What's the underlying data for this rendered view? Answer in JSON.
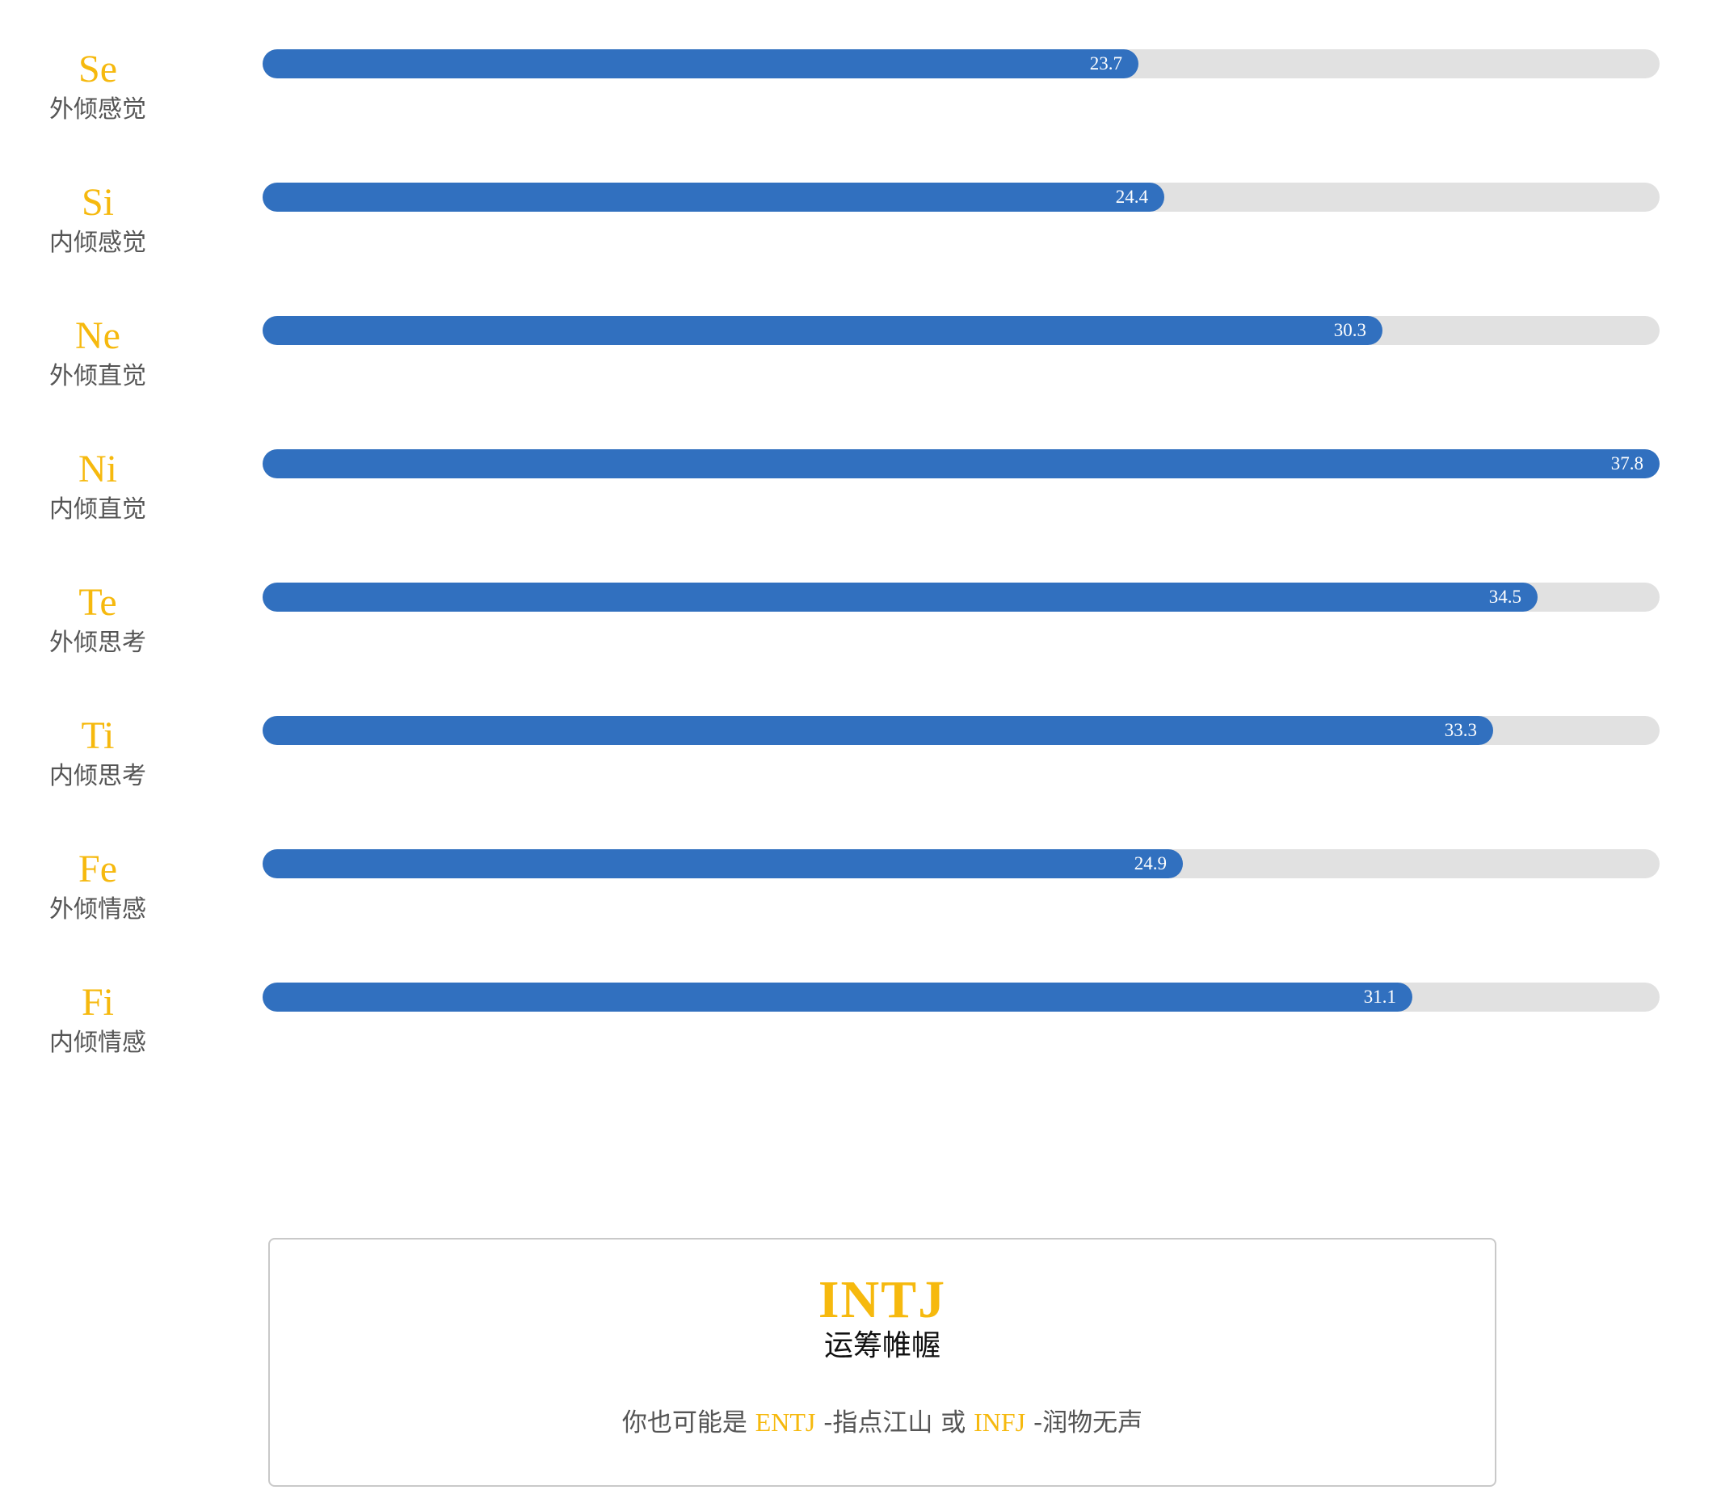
{
  "functions": [
    {
      "code": "Se",
      "name": "外倾感觉",
      "value": 23.7,
      "value_text": "23.7"
    },
    {
      "code": "Si",
      "name": "内倾感觉",
      "value": 24.4,
      "value_text": "24.4"
    },
    {
      "code": "Ne",
      "name": "外倾直觉",
      "value": 30.3,
      "value_text": "30.3"
    },
    {
      "code": "Ni",
      "name": "内倾直觉",
      "value": 37.8,
      "value_text": "37.8"
    },
    {
      "code": "Te",
      "name": "外倾思考",
      "value": 34.5,
      "value_text": "34.5"
    },
    {
      "code": "Ti",
      "name": "内倾思考",
      "value": 33.3,
      "value_text": "33.3"
    },
    {
      "code": "Fe",
      "name": "外倾情感",
      "value": 24.9,
      "value_text": "24.9"
    },
    {
      "code": "Fi",
      "name": "内倾情感",
      "value": 31.1,
      "value_text": "31.1"
    }
  ],
  "scale_max": 37.8,
  "result": {
    "type_code": "INTJ",
    "type_name": "运筹帷幄",
    "alt_prefix": "你也可能是 ",
    "alt1_code": "ENTJ",
    "alt1_name": " -指点江山 ",
    "alt_or": "或 ",
    "alt2_code": "INFJ",
    "alt2_name": " -润物无声"
  },
  "colors": {
    "accent": "#f6b90e",
    "bar_fill": "#3170bf",
    "bar_track": "#e1e1e1",
    "label_text": "#555555"
  }
}
